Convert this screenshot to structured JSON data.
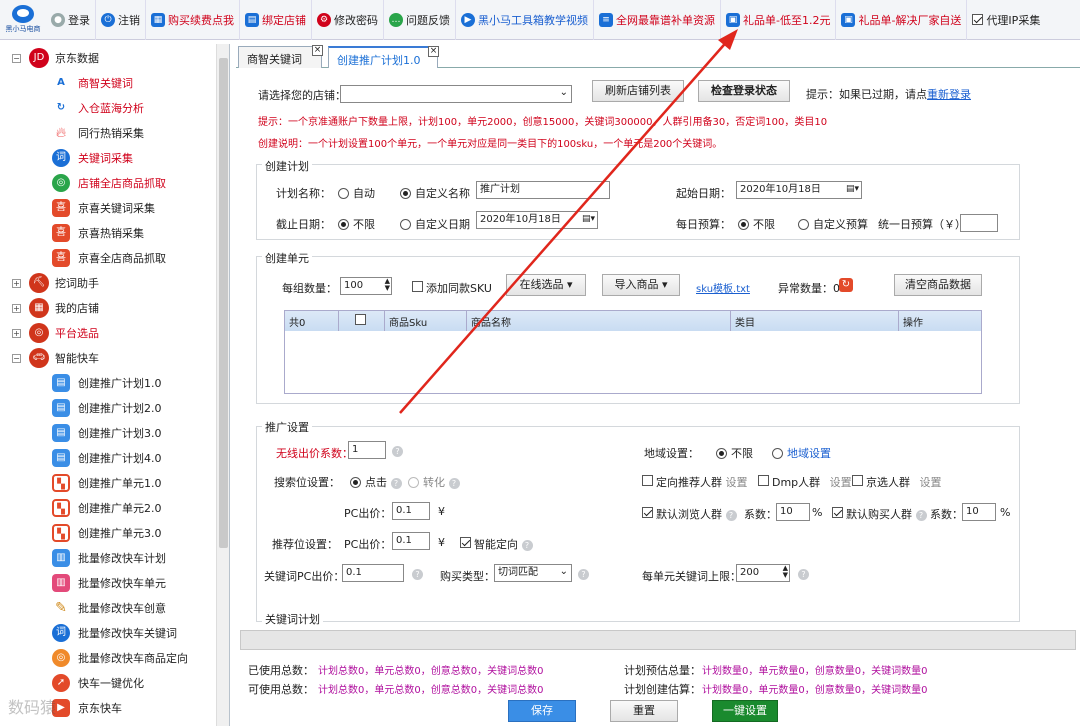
{
  "toolbar": {
    "logo_text": "黑小马电商",
    "login": "登录",
    "logout": "注销",
    "buy_points": "购买续费点我",
    "bind_shop": "绑定店铺",
    "change_pwd": "修改密码",
    "feedback": "问题反馈",
    "video": "黑小马工具箱教学视频",
    "best_source": "全网最靠谱补单资源",
    "gift_cheap": "礼品单-低至1.2元",
    "gift_factory": "礼品单-解决厂家自送",
    "proxy_ip": "代理IP采集"
  },
  "sidebar": {
    "root": "京东数据",
    "jd_items": [
      "商智关键词",
      "入仓蓝海分析",
      "同行热销采集",
      "关键词采集",
      "店铺全店商品抓取",
      "京喜关键词采集",
      "京喜热销采集",
      "京喜全店商品抓取"
    ],
    "groups": [
      "挖词助手",
      "我的店铺",
      "平台选品",
      "智能快车"
    ],
    "kc_items": [
      "创建推广计划1.0",
      "创建推广计划2.0",
      "创建推广计划3.0",
      "创建推广计划4.0",
      "创建推广单元1.0",
      "创建推广单元2.0",
      "创建推广单元3.0",
      "批量修改快车计划",
      "批量修改快车单元",
      "批量修改快车创意",
      "批量修改快车关键词",
      "批量修改快车商品定向",
      "快车一键优化",
      "京东快车"
    ],
    "watermark": "数码猿"
  },
  "tabs": {
    "tab1": "商智关键词",
    "tab2": "创建推广计划1.0",
    "close": "×"
  },
  "form": {
    "select_shop_label": "请选择您的店铺：",
    "refresh_btn": "刷新店铺列表",
    "check_login_btn": "检查登录状态",
    "hint_prefix": "提示：如果已过期，请点",
    "relogin": "重新登录",
    "tip_line": "提示：一个京准通账户下数量上限，计划100，单元2000，创意15000，关键词300000，人群引用备30，否定词100，类目10",
    "desc_line": "创建说明：一个计划设置100个单元，一个单元对应是同一类目下的100sku，一个单元是200个关键词。"
  },
  "plan": {
    "title": "创建计划",
    "name_label": "计划名称：",
    "auto": "自动",
    "custom_name": "自定义名称",
    "name_value": "推广计划",
    "start_label": "起始日期：",
    "start_value": "2020年10月18日",
    "end_label": "截止日期：",
    "unlimited": "不限",
    "custom_date": "自定义日期",
    "end_value": "2020年10月18日",
    "budget_label": "每日预算：",
    "custom_budget": "自定义预算",
    "uniform_budget": "统一日预算（￥）"
  },
  "unit": {
    "title": "创建单元",
    "count_label": "每组数量：",
    "count_value": "100",
    "same_sku": "添加同款SKU",
    "online_pick": "在线选品",
    "import": "导入商品",
    "sku_template": "sku模板.txt",
    "abnormal": "异常数量：0",
    "clear": "清空商品数据",
    "headers": [
      "共0",
      "",
      "商品Sku",
      "商品名称",
      "类目",
      "操作"
    ]
  },
  "promo": {
    "title": "推广设置",
    "wireless_label": "无线出价系数：",
    "wireless_value": "1",
    "region_label": "地域设置：",
    "unlimited": "不限",
    "region_set": "地域设置",
    "search_label": "搜索位设置：",
    "click": "点击",
    "convert": "转化",
    "directed": "定向推荐人群",
    "setting": "设置",
    "dmp": "Dmp人群",
    "jx": "京选人群",
    "pc_bid_label": "PC出价：",
    "pc_bid_value": "0.1",
    "yen": "¥",
    "default_browse": "默认浏览人群",
    "coef_label": "系数：",
    "coef_value": "10",
    "pct": "%",
    "default_buy": "默认购买人群",
    "recommend_label": "推荐位设置：",
    "smart": "智能定向",
    "kw_pc_label": "关键词PC出价：",
    "kw_pc_value": "0.1",
    "buy_type_label": "购买类型：",
    "buy_type_value": "切词匹配",
    "kw_limit_label": "每单元关键词上限：",
    "kw_limit_value": "200"
  },
  "kw_plan": {
    "title": "关键词计划"
  },
  "footer": {
    "used_label": "已使用总数：",
    "used_value": "计划总数0，单元总数0，创意总数0，关键词总数0",
    "avail_label": "可使用总数：",
    "avail_value": "计划总数0，单元总数0，创意总数0，关键词总数0",
    "est_label": "计划预估总量：",
    "est_value": "计划数量0，单元数量0，创意数量0，关键词数量0",
    "create_label": "计划创建估算：",
    "create_value": "计划数量0，单元数量0，创意数量0，关键词数量0",
    "save": "保存",
    "reset": "重置",
    "oneclick": "一键设置"
  },
  "colors": {
    "accent": "#1a6fd6",
    "alert": "#d0021b",
    "magenta": "#b0109e",
    "save_bg": "#3a8ee6",
    "oneclick_bg": "#1a8a2e",
    "arrow": "#e0261c"
  }
}
